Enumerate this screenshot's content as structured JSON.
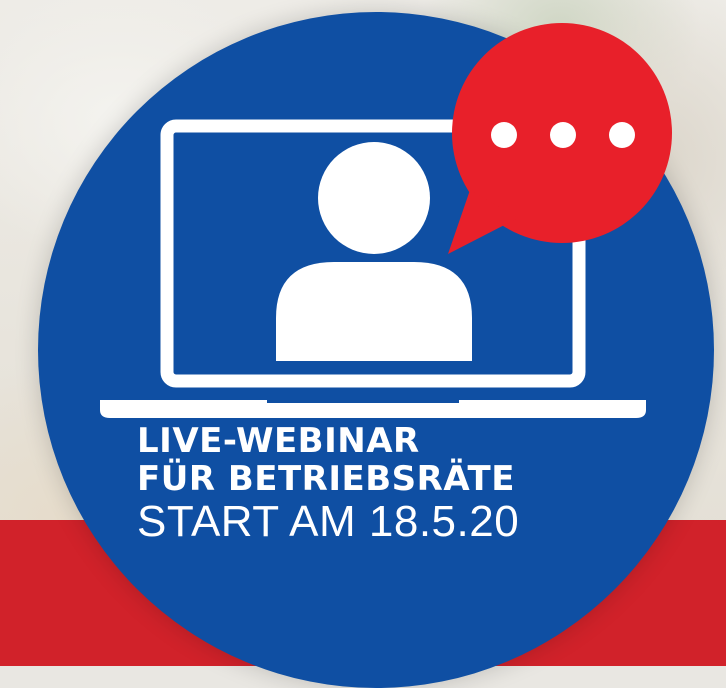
{
  "banner": {
    "line1": "LIVE-WEBINAR",
    "line2": "FÜR BETRIEBSRÄTE",
    "line3": "START AM 18.5.20"
  },
  "icons": [
    "laptop-icon",
    "person-icon",
    "speech-bubble-icon",
    "ellipsis-icon"
  ],
  "colors": {
    "circle": "#0f4fa3",
    "band": "#d1222a",
    "bubble": "#e8202a",
    "icon": "#ffffff"
  }
}
